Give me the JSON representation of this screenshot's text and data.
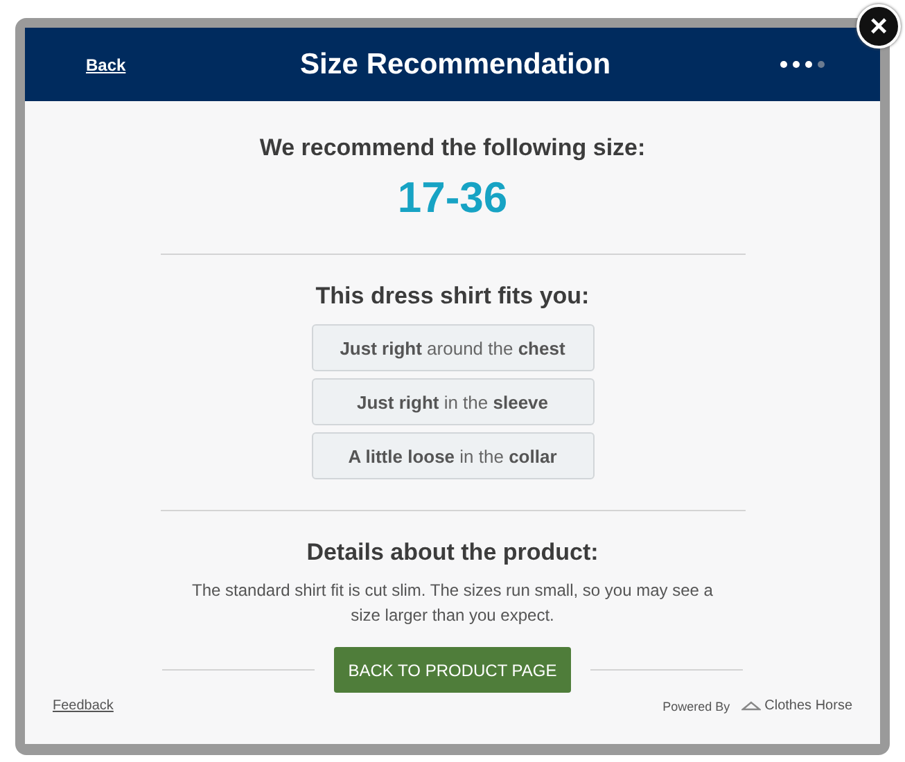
{
  "header": {
    "back_link": "Back",
    "title": "Size Recommendation",
    "steps": [
      {
        "active": true
      },
      {
        "active": true
      },
      {
        "active": true
      },
      {
        "active": false
      }
    ]
  },
  "close_button": "×",
  "recommendation": {
    "heading": "We recommend the following size:",
    "size": "17-36"
  },
  "fit": {
    "heading": "This dress shirt fits you:",
    "items": [
      "**Just right** around the **chest**",
      "**Just right** in the **sleeve**",
      "**A little loose** in the **collar**"
    ]
  },
  "details": {
    "heading": "Details about the product:",
    "text": "The standard shirt fit is cut slim. The sizes run small, so you may see a size larger than you expect."
  },
  "back_button": "BACK TO PRODUCT PAGE",
  "footer": {
    "feedback_link": "Feedback",
    "powered_by": "Powered By",
    "brand": "Clothes Horse"
  }
}
